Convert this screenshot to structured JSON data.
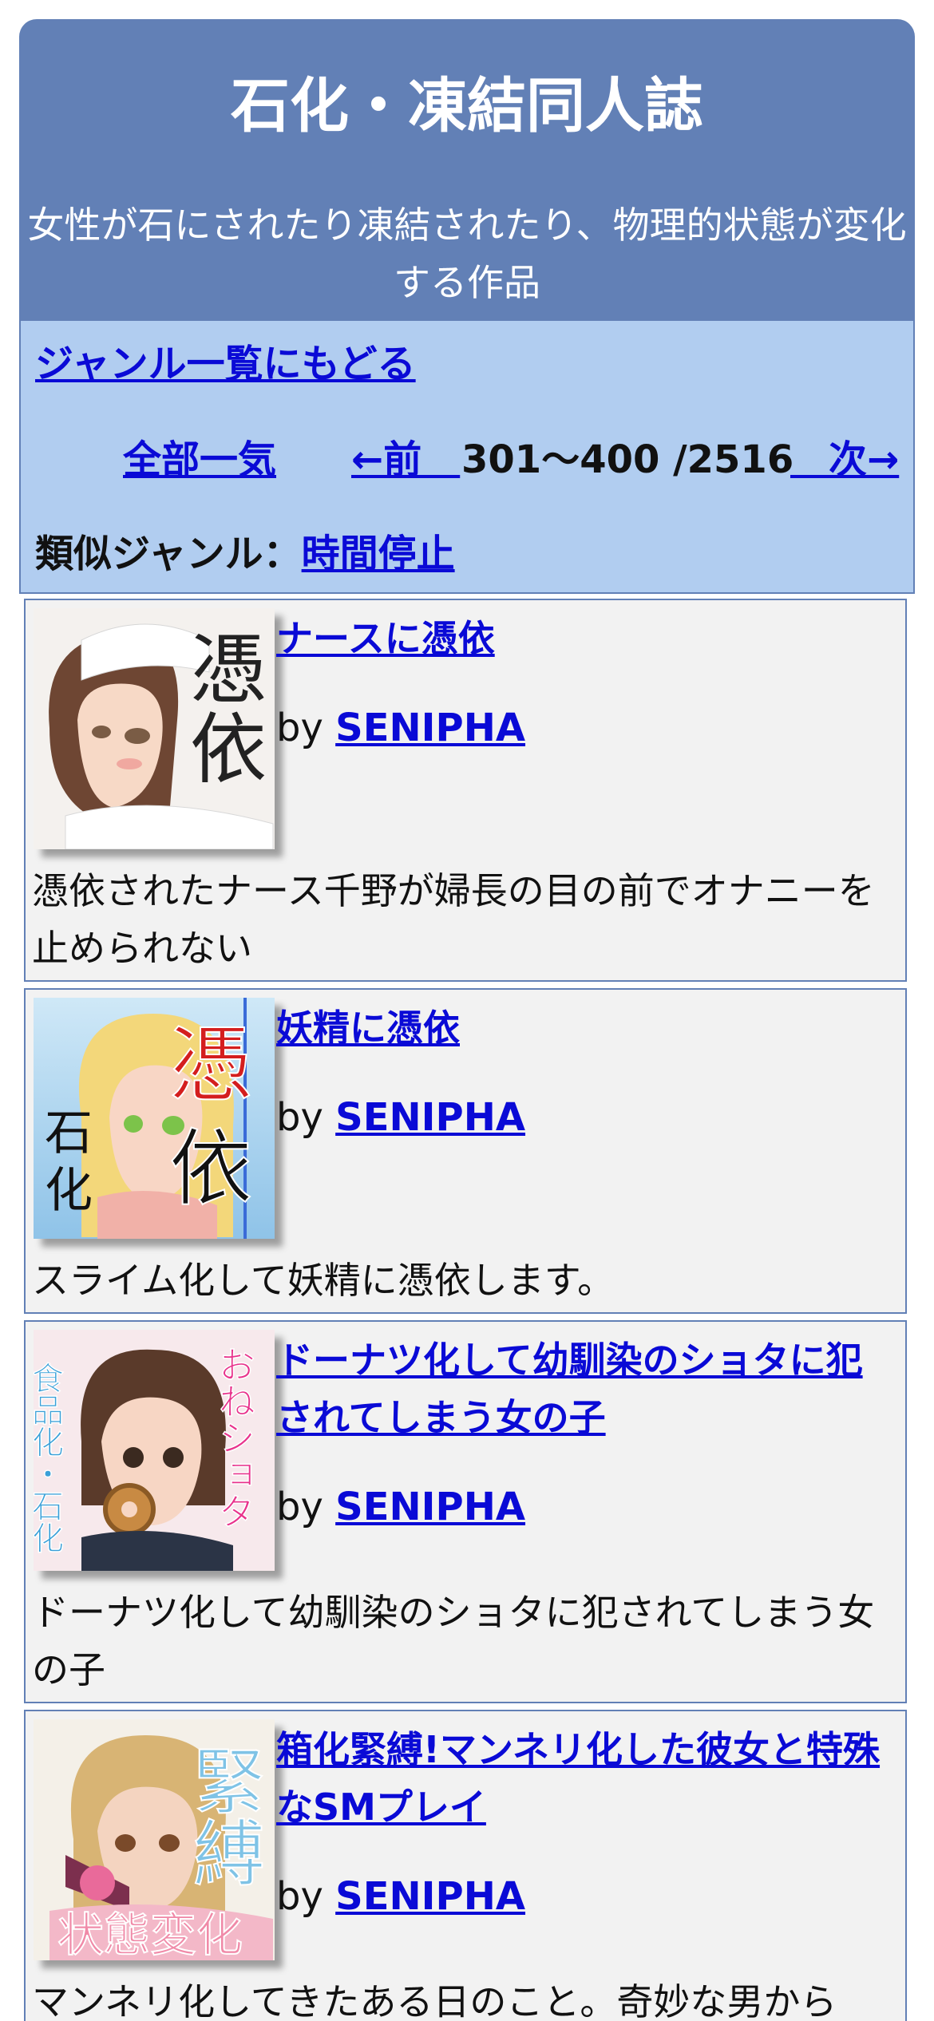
{
  "header": {
    "title": "石化・凍結同人誌",
    "description": "女性が石にされたり凍結されたり、物理的状態が変化する作品"
  },
  "nav": {
    "back_label": "ジャンル一覧にもどる",
    "all_label": "全部一気",
    "prev_label": "←前　",
    "range_text": "301〜400 /2516",
    "next_label": "　次→",
    "similar_label": "類似ジャンル：",
    "similar_link": "時間停止"
  },
  "items": [
    {
      "title": "ナースに憑依",
      "by": "by ",
      "author": "SENIPHA",
      "summary": "憑依されたナース千野が婦長の目の前でオナニーを止められない",
      "thumb_text": [
        "憑",
        "依"
      ]
    },
    {
      "title": "妖精に憑依",
      "by": "by ",
      "author": "SENIPHA",
      "summary": "スライム化して妖精に憑依します。",
      "thumb_text": [
        "憑",
        "依",
        "石",
        "化"
      ]
    },
    {
      "title": "ドーナツ化して幼馴染のショタに犯されてしまう女の子",
      "by": "by ",
      "author": "SENIPHA",
      "summary": "ドーナツ化して幼馴染のショタに犯されてしまう女の子",
      "thumb_text": [
        "食品化・石化",
        "おねショタ"
      ]
    },
    {
      "title": "箱化緊縛!マンネリ化した彼女と特殊なSMプレイ",
      "by": "by ",
      "author": "SENIPHA",
      "summary": "マンネリ化してきたある日のこと。奇妙な男から",
      "thumb_text": [
        "緊",
        "縛",
        "状態変化"
      ]
    }
  ]
}
